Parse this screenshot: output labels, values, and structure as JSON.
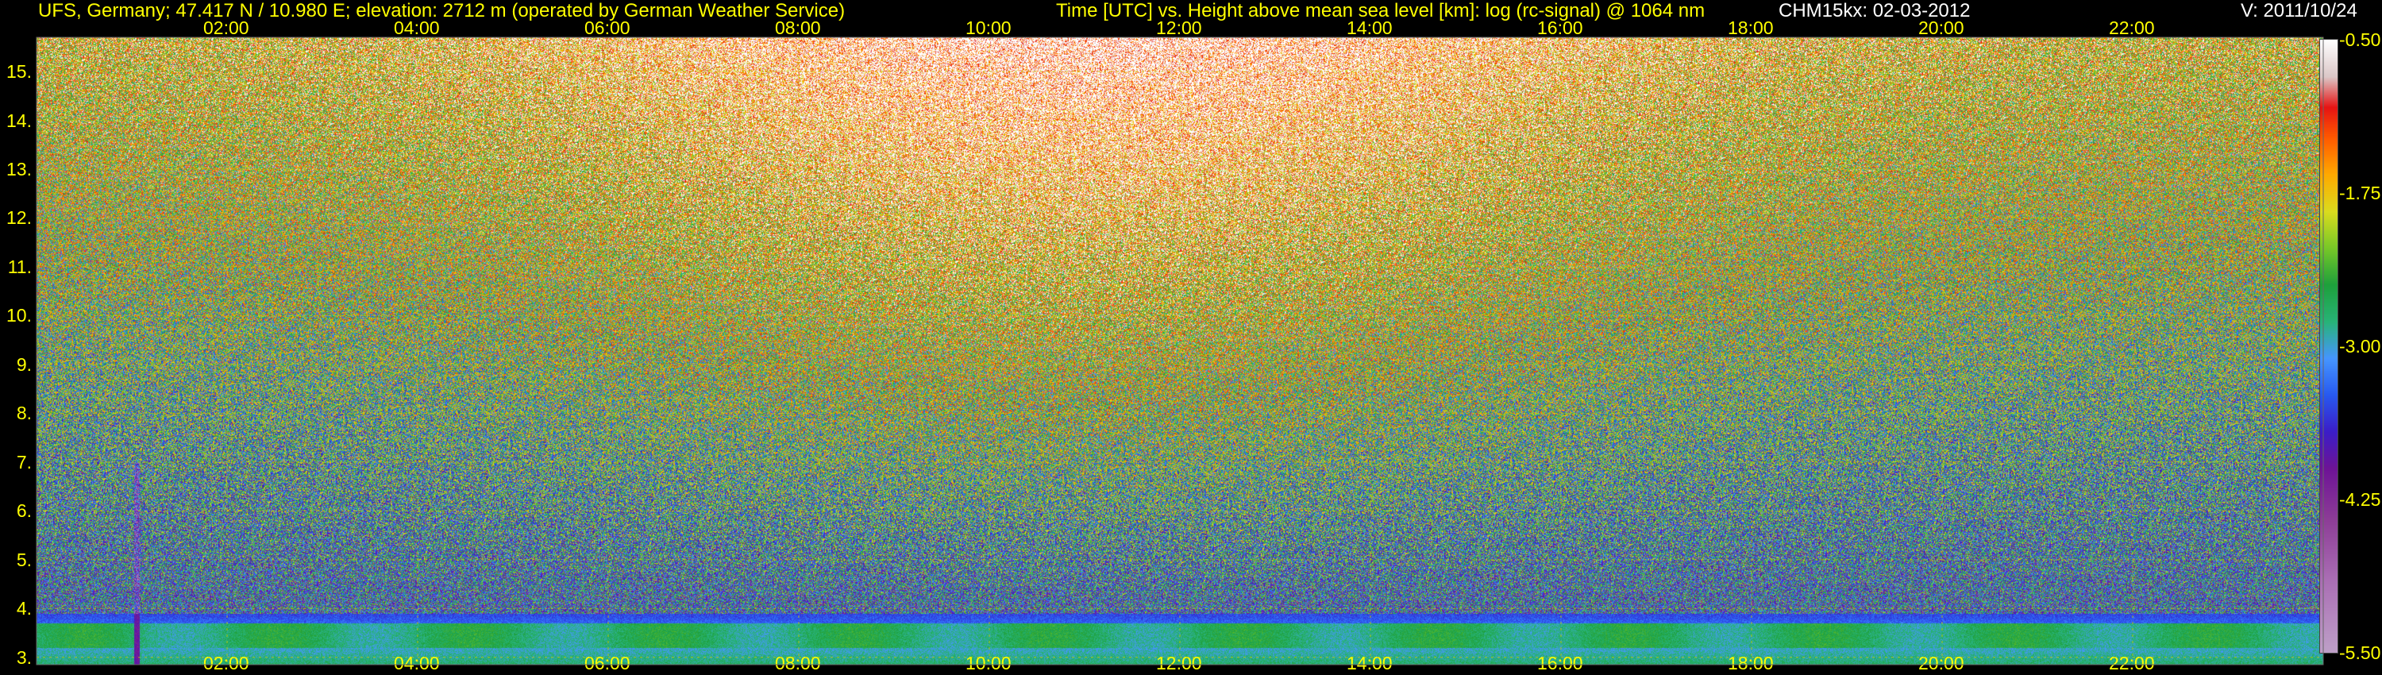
{
  "header": {
    "station": "UFS, Germany; 47.417 N / 10.980 E; elevation: 2712 m  (operated by German Weather Service)",
    "axis_desc": "Time [UTC] vs. Height above mean sea level [km]: log (rc-signal) @ 1064 nm",
    "instrument": "CHM15kx: 02-03-2012",
    "version": "V: 2011/10/24"
  },
  "colors": {
    "background": "#000000",
    "text": "#ffff00",
    "grid": "#c8c800"
  },
  "chart_data": {
    "type": "heatmap",
    "title": "Time [UTC] vs. Height above mean sea level [km]: log (rc-signal) @ 1064 nm",
    "xlabel": "Time [UTC]",
    "ylabel": "Height above mean sea level [km]",
    "x_ticks": [
      "02:00",
      "04:00",
      "06:00",
      "08:00",
      "10:00",
      "12:00",
      "14:00",
      "16:00",
      "18:00",
      "20:00",
      "22:00"
    ],
    "x_tick_hours": [
      2,
      4,
      6,
      8,
      10,
      12,
      14,
      16,
      18,
      20,
      22
    ],
    "xlim": [
      0,
      24
    ],
    "y_ticks": [
      "3.",
      "4.",
      "5.",
      "6.",
      "7.",
      "8.",
      "9.",
      "10.",
      "11.",
      "12.",
      "13.",
      "14.",
      "15."
    ],
    "y_tick_values": [
      3,
      4,
      5,
      6,
      7,
      8,
      9,
      10,
      11,
      12,
      13,
      14,
      15
    ],
    "ylim": [
      2.85,
      15.7
    ],
    "grid": true,
    "colorbar": {
      "labels": [
        "-0.50",
        "-1.75",
        "-3.00",
        "-4.25",
        "-5.50"
      ],
      "values": [
        -0.5,
        -1.75,
        -3.0,
        -4.25,
        -5.5
      ],
      "range": [
        -5.5,
        -0.5
      ]
    },
    "features": {
      "boundary_layer_top_km": 3.9,
      "dense_layer_km": [
        3.2,
        3.7
      ],
      "instrument_gap_hour": 1.05
    }
  }
}
